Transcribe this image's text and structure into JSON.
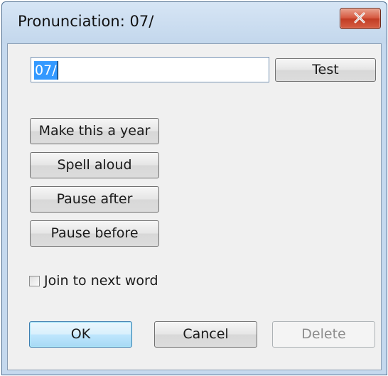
{
  "dialog": {
    "title": "Pronunciation: 07/",
    "close_icon": "close-icon"
  },
  "input": {
    "value": "07/"
  },
  "buttons": {
    "test": "Test",
    "make_year": "Make this a year",
    "spell_aloud": "Spell aloud",
    "pause_after": "Pause after",
    "pause_before": "Pause before",
    "ok": "OK",
    "cancel": "Cancel",
    "delete": "Delete"
  },
  "checkbox": {
    "label": "Join to next word",
    "checked": false
  },
  "colors": {
    "selection": "#3399ff",
    "close_button": "#c74a33",
    "default_button_border": "#3c7fb1"
  }
}
